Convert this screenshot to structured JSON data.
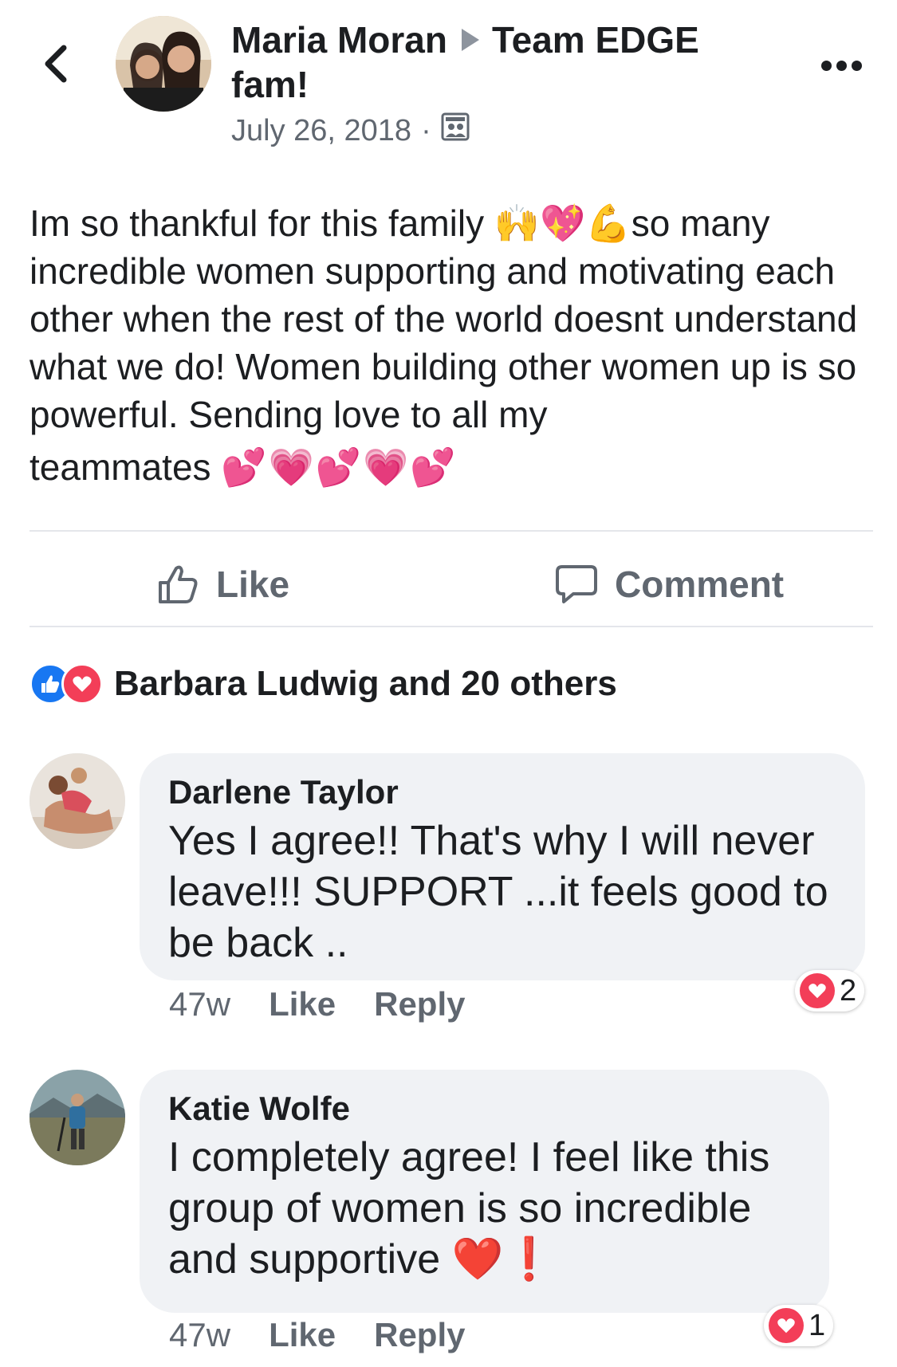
{
  "post": {
    "author": "Maria Moran",
    "group": "Team EDGE",
    "group_cont": "fam!",
    "date": "July 26, 2018",
    "separator": "·",
    "privacy_icon": "group-audience-icon",
    "text_line1_a": "Im so thankful for this family ",
    "emoji_1": "🙌💖💪",
    "text_line1_b": "so many",
    "text_rest": "incredible women supporting and motivating each other when the rest of the world doesnt understand what we do! Women building other women up is so powerful. Sending love to all my",
    "text_last": "teammates ",
    "emoji_2": "💕💗💕💗💕"
  },
  "actions": {
    "like_label": "Like",
    "comment_label": "Comment"
  },
  "reactions": {
    "summary": "Barbara Ludwig and 20 others",
    "types": [
      "like",
      "love"
    ]
  },
  "comments": [
    {
      "name": "Darlene Taylor",
      "text": "Yes I agree!! That's why I will never leave!!! SUPPORT ...it feels good to be back ..",
      "time": "47w",
      "like_label": "Like",
      "reply_label": "Reply",
      "reaction_count": "2"
    },
    {
      "name": "Katie Wolfe",
      "text": "I completely agree! I feel like this group of women is so incredible and supportive ",
      "emoji": "❤️❗",
      "time": "47w",
      "like_label": "Like",
      "reply_label": "Reply",
      "reaction_count": "1"
    }
  ],
  "colors": {
    "like_blue": "#1877f2",
    "love_red": "#f33e58",
    "secondary_text": "#606770",
    "bubble_bg": "#f0f2f5"
  }
}
